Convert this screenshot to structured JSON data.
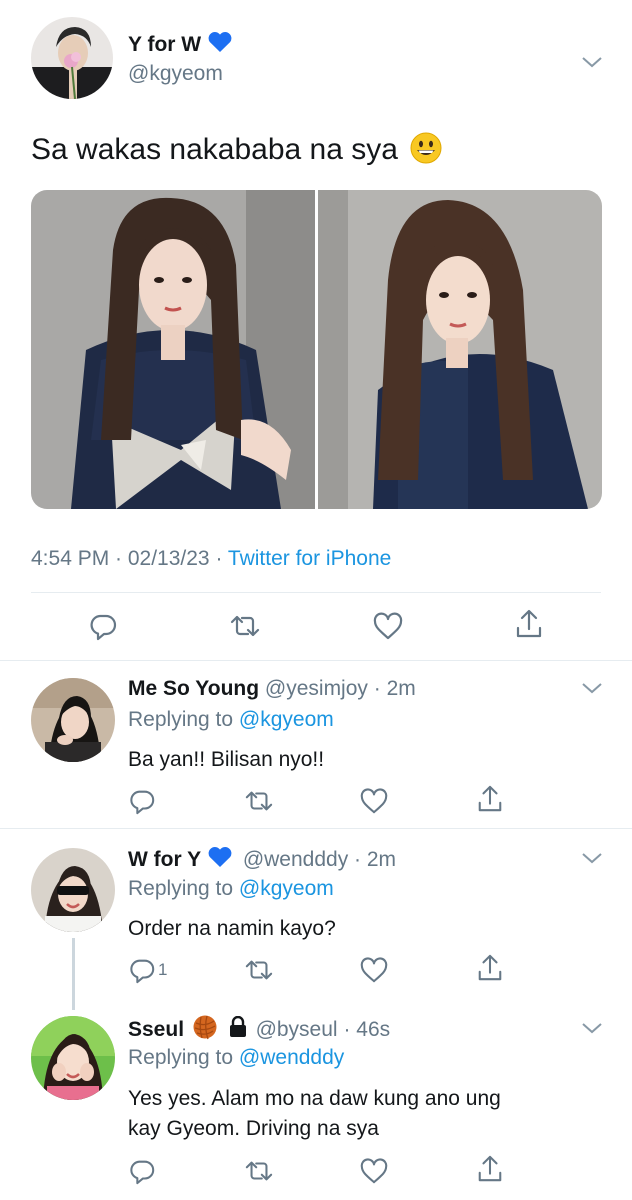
{
  "main_tweet": {
    "display_name": "Y for W",
    "handle": "@kgyeom",
    "text": "Sa wakas nakababa na sya",
    "timestamp": "4:54 PM · 02/13/23 · ",
    "source": "Twitter for iPhone"
  },
  "replies": [
    {
      "display_name": "Me So Young",
      "handle": "@yesimjoy",
      "time": "· 2m",
      "replying_prefix": "Replying to ",
      "replying_to": "@kgyeom",
      "text": "Ba yan!! Bilisan nyo!!",
      "reply_count": ""
    },
    {
      "display_name": "W for Y",
      "handle": "@wendddy",
      "time": "· 2m",
      "replying_prefix": "Replying to ",
      "replying_to": "@kgyeom",
      "text": "Order na namin kayo?",
      "reply_count": "1"
    },
    {
      "display_name": "Sseul",
      "handle": "@byseul",
      "time": "· 46s",
      "replying_prefix": "Replying to ",
      "replying_to": "@wendddy",
      "text_line1": "Yes yes. Alam mo na daw kung ano ung",
      "text_line2": "kay Gyeom. Driving na sya",
      "reply_count": ""
    }
  ],
  "icons": {
    "verified": "blue-heart-icon",
    "reply": "reply-icon",
    "retweet": "retweet-icon",
    "like": "like-icon",
    "share": "share-icon",
    "more": "chevron-down-icon",
    "locked": "lock-icon",
    "yarn": "yarn-ball-icon",
    "emoji": "grinning-face-icon"
  },
  "colors": {
    "text": "#14171a",
    "secondary": "#657786",
    "link": "#1b95e0",
    "heart": "#1d6ff2",
    "divider": "#e6ecf0"
  }
}
